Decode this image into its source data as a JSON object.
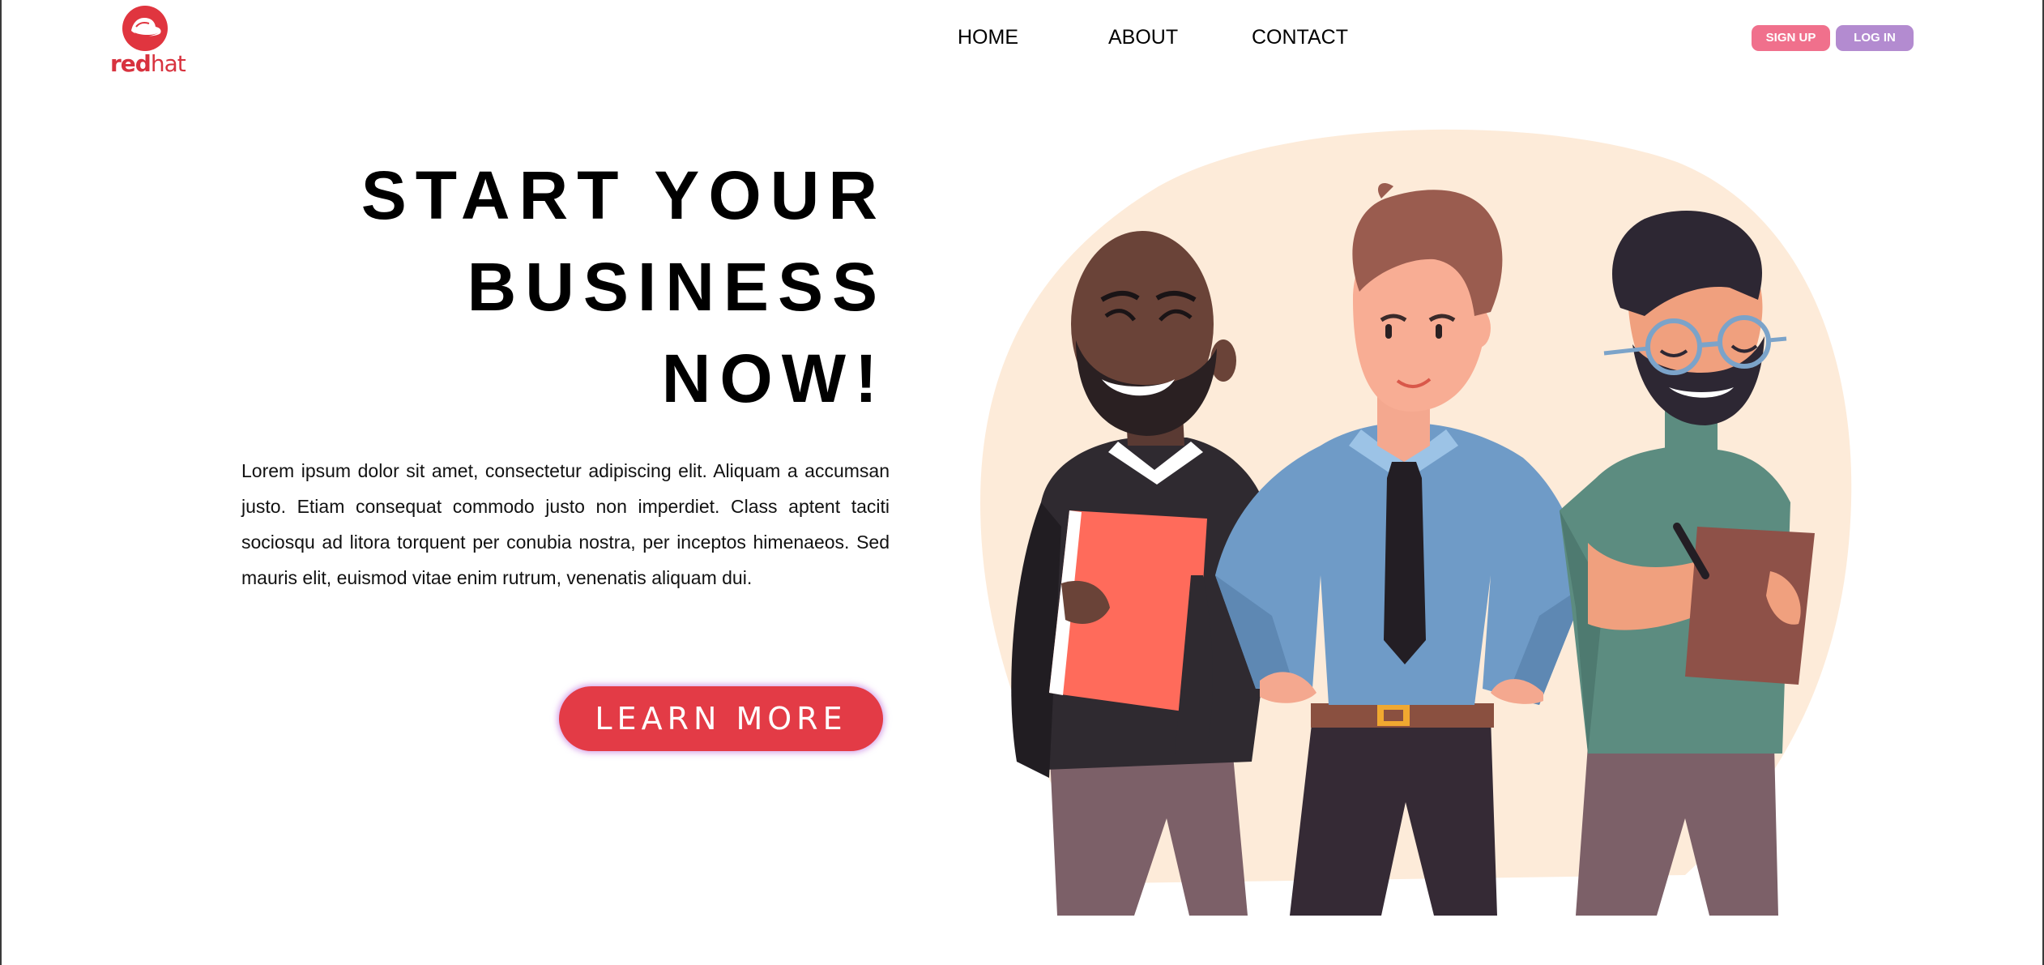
{
  "brand": {
    "logo_bold": "red",
    "logo_light": "hat"
  },
  "nav": {
    "home": "HOME",
    "about": "ABOUT",
    "contact": "CONTACT"
  },
  "auth": {
    "signup": "SIGN UP",
    "login": "LOG IN"
  },
  "hero": {
    "headline_lines": [
      "START YOUR",
      "BUSINESS",
      "NOW!"
    ],
    "body": "Lorem ipsum dolor sit amet, consectetur adipiscing elit. Aliquam a accumsan justo. Etiam consequat commodo justo non imperdiet. Class aptent taciti sociosqu ad litora torquent per conubia nostra, per inceptos himenaeos. Sed mauris elit, euismod vitae enim rutrum, venenatis aliquam dui.",
    "cta": "LEARN MORE"
  },
  "colors": {
    "brand_red": "#e33b46",
    "signup_pink": "#f0708c",
    "login_purple": "#b38bd0",
    "blob_peach": "#fdebd9"
  },
  "icons": {
    "logo": "redhat-logo-icon",
    "illustration": "three-businessmen-illustration"
  }
}
